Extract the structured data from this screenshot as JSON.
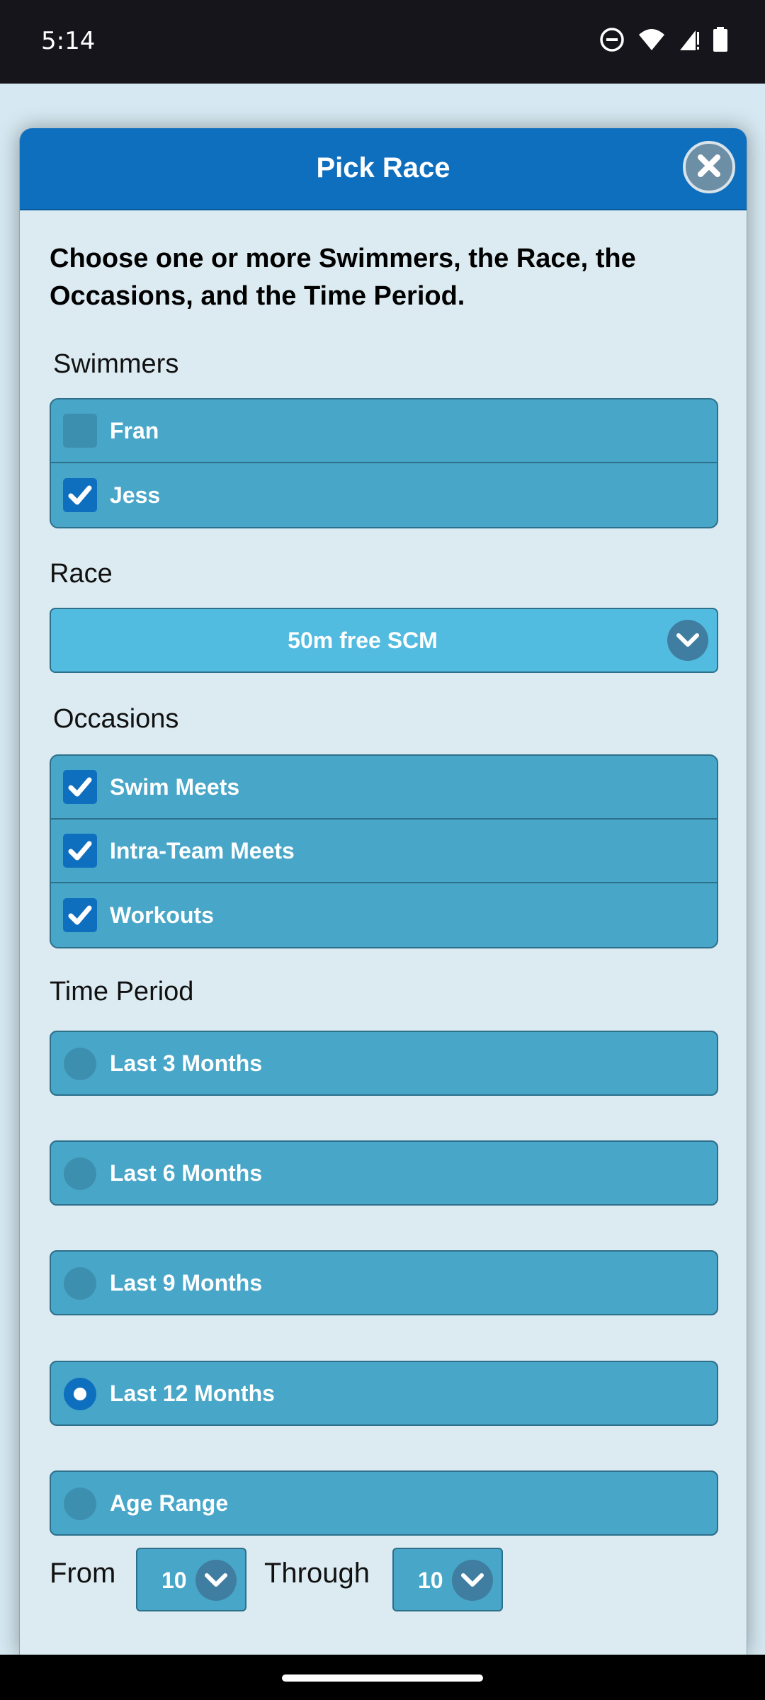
{
  "status_bar": {
    "time": "5:14",
    "icons": [
      "do-not-disturb-icon",
      "wifi-icon",
      "signal-icon",
      "battery-icon"
    ]
  },
  "dialog": {
    "title": "Pick Race",
    "close_icon": "close-icon",
    "instructions": "Choose one or more Swimmers, the Race, the Occasions, and the Time Period."
  },
  "swimmers": {
    "label": "Swimmers",
    "items": [
      {
        "label": "Fran",
        "checked": false
      },
      {
        "label": "Jess",
        "checked": true
      }
    ]
  },
  "race": {
    "label": "Race",
    "selected": "50m free SCM"
  },
  "occasions": {
    "label": "Occasions",
    "items": [
      {
        "label": "Swim Meets",
        "checked": true
      },
      {
        "label": "Intra-Team Meets",
        "checked": true
      },
      {
        "label": "Workouts",
        "checked": true
      }
    ]
  },
  "time_period": {
    "label": "Time Period",
    "options": [
      {
        "label": "Last 3 Months",
        "selected": false
      },
      {
        "label": "Last 6 Months",
        "selected": false
      },
      {
        "label": "Last 9 Months",
        "selected": false
      },
      {
        "label": "Last 12 Months",
        "selected": true
      },
      {
        "label": "Age Range",
        "selected": false
      }
    ]
  },
  "age_range": {
    "from_label": "From",
    "from_value": "10",
    "through_label": "Through",
    "through_value": "10"
  },
  "colors": {
    "header": "#0f6fbf",
    "row_bg": "#48a6c8",
    "select_bg": "#52bbe0",
    "checked": "#0f6fbf"
  }
}
